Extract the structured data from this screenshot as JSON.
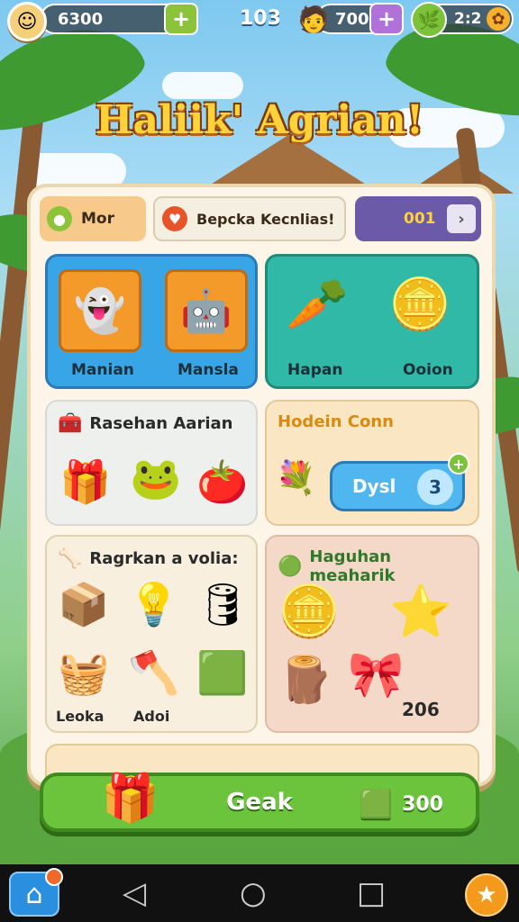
{
  "hud": {
    "coins": "6300",
    "level": "103",
    "gems": "700",
    "energy": "2:2"
  },
  "title": "Haliik' Agrian!",
  "tabs": [
    {
      "label": "Mor"
    },
    {
      "label": "Bepcka Kecnlias!"
    },
    {
      "label": "001"
    }
  ],
  "top_left_card": {
    "items": [
      "Manian",
      "Mansla"
    ]
  },
  "top_right_card": {
    "items": [
      "Hapan",
      "Ooion"
    ]
  },
  "middle_left_card": {
    "title": "Rasehan Aarian"
  },
  "middle_right_card": {
    "title": "Hodein Conn",
    "button_label": "Dysl",
    "button_value": "3"
  },
  "lower_left_card": {
    "title": "Ragrkan a volia:",
    "captions": [
      "Leoka",
      "Adoi"
    ]
  },
  "lower_right_card": {
    "title": "Haguhan meaharik",
    "value": "206"
  },
  "action": {
    "label": "Geak",
    "cost": "300"
  },
  "icons": {
    "avatar": "avatar-icon",
    "home": "home-icon",
    "back": "back-icon",
    "recents": "recents-icon",
    "star": "star-icon"
  }
}
